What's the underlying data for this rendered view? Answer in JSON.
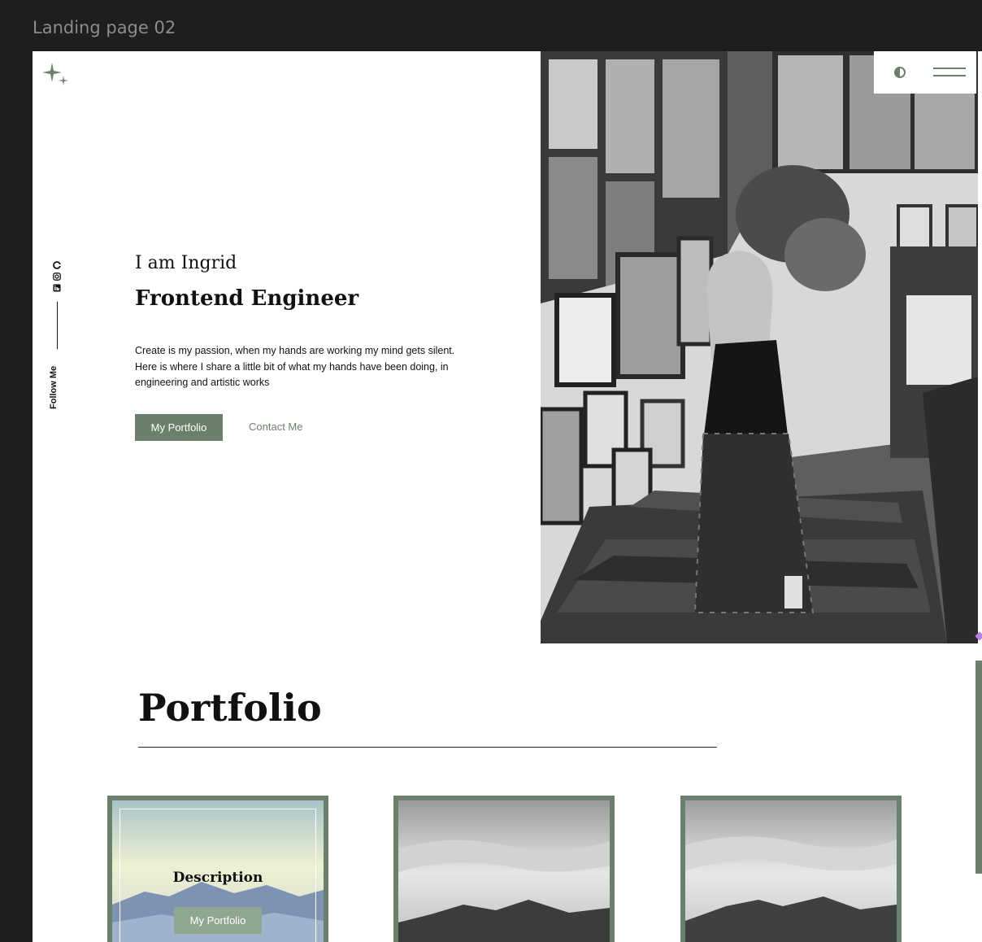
{
  "frame": {
    "label": "Landing page 02"
  },
  "hero": {
    "greeting": "I am Ingrid",
    "role": "Frontend Engineer",
    "bio": "Create is my passion, when my hands are working my mind gets silent. Here is where I share a little bit of what my hands have been doing, in engineering and artistic works",
    "primary_button": "My Portfolio",
    "secondary_button": "Contact Me"
  },
  "social": {
    "follow_label": "Follow Me",
    "icons": [
      "github-icon",
      "instagram-icon",
      "linkedin-icon"
    ]
  },
  "header": {
    "icons": [
      "theme-toggle-icon",
      "menu-icon"
    ]
  },
  "portfolio": {
    "title": "Portfolio",
    "cards": [
      {
        "description": "Description",
        "button": "My Portfolio"
      },
      {},
      {}
    ]
  },
  "colors": {
    "accent": "#6b806b",
    "accent_light": "#8fa68f",
    "canvas": "#ffffff",
    "background": "#1e1e1e"
  }
}
